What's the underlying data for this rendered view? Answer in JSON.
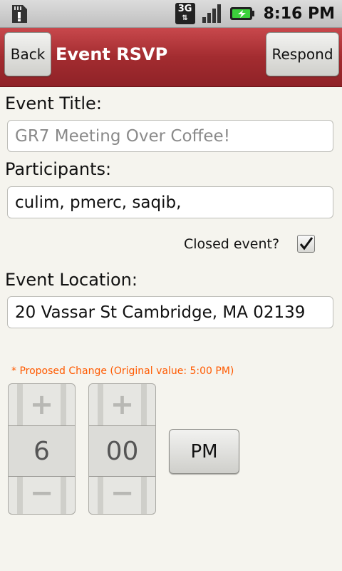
{
  "status_bar": {
    "time": "8:16 PM",
    "network": "3G",
    "icons": [
      "sd-card-alert-icon",
      "3g-icon",
      "signal-icon",
      "battery-charging-icon"
    ]
  },
  "header": {
    "back_label": "Back",
    "title": "Event RSVP",
    "respond_label": "Respond"
  },
  "form": {
    "event_title_label": "Event Title:",
    "event_title_placeholder": "GR7 Meeting Over Coffee!",
    "participants_label": "Participants:",
    "participants_value": "culim,  pmerc,  saqib,",
    "closed_event_label": "Closed event?",
    "closed_event_checked": true,
    "location_label": "Event Location:",
    "location_value": "20 Vassar St Cambridge, MA 02139",
    "proposed_change": "* Proposed Change (Original value: 5:00 PM)"
  },
  "time_picker": {
    "hour": "6",
    "minute": "00",
    "ampm": "PM",
    "increment_symbol": "+",
    "decrement_symbol": "−"
  },
  "colors": {
    "header_red": "#a32c30",
    "proposed_orange": "#ff5a00",
    "background": "#f5f4ee"
  }
}
